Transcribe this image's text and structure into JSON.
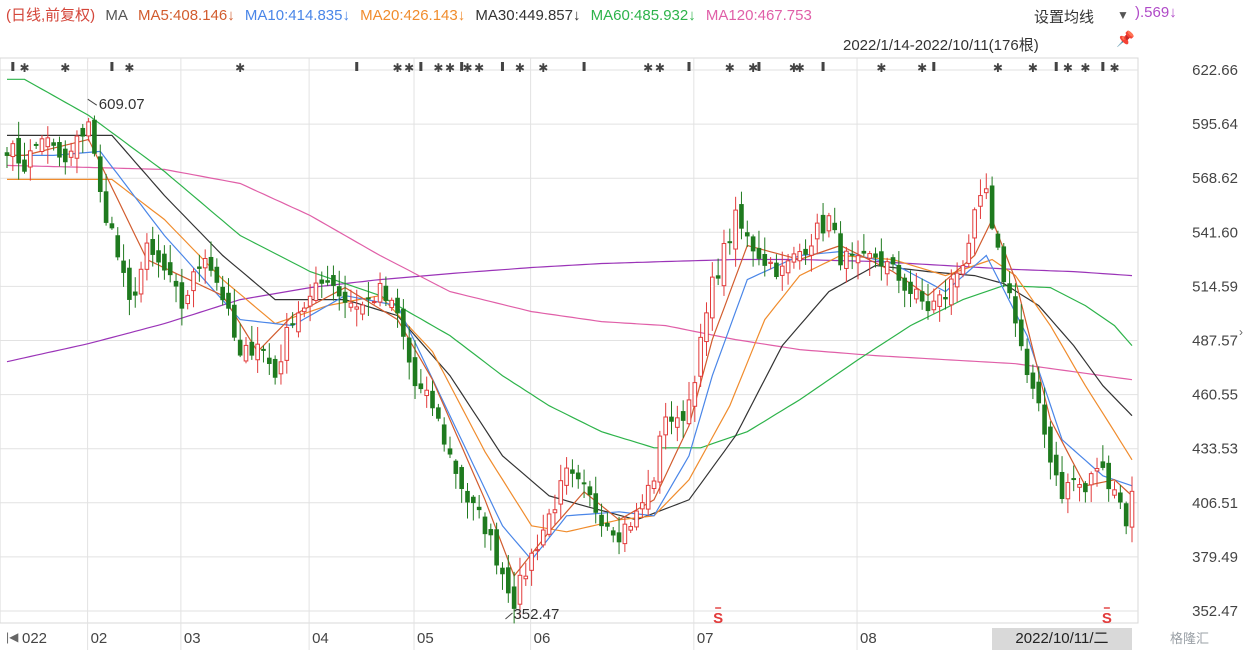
{
  "header": {
    "prefix": "(日线,前复权)",
    "ma_label": "MA",
    "ma5": "MA5:408.146↓",
    "ma10": "MA10:414.835↓",
    "ma20": "MA20:426.143↓",
    "ma30": "MA30:449.857↓",
    "ma60": "MA60:485.932↓",
    "ma120": "MA120:467.753",
    "ma_tail": ").569↓",
    "settings": "设置均线",
    "range": "2022/1/14-2022/10/11(176根)",
    "current_date": "2022/10/11/二",
    "watermark": "格隆汇",
    "nav_icon": "skip-back-icon",
    "pin_icon": "pin-icon",
    "colors": {
      "prefix": "#d4463a",
      "ma5": "#d25c2e",
      "ma10": "#4a86e8",
      "ma20": "#f08c2d",
      "ma30": "#333333",
      "ma60": "#2db34a",
      "ma120": "#e05fa8",
      "ma250": "#9b34b8",
      "up": "#e23b3b",
      "down": "#1f7a1f",
      "grid": "#e2e2e2"
    }
  },
  "chart_data": {
    "type": "candlestick",
    "y_ticks": [
      "622.66",
      "595.64",
      "568.62",
      "541.60",
      "514.59",
      "487.57",
      "460.55",
      "433.53",
      "406.51",
      "379.49",
      "352.47"
    ],
    "ylim": [
      352.47,
      622.66
    ],
    "x_labels": [
      "022",
      "02",
      "03",
      "04",
      "05",
      "06",
      "07",
      "08"
    ],
    "x_label_dates": [
      "2022-01-14",
      "2022-02-07",
      "2022-03-01",
      "2022-04-01",
      "2022-05-05",
      "2022-06-01",
      "2022-07-01",
      "2022-08-01"
    ],
    "annotations": [
      {
        "text": "609.07",
        "date": "2022-01-28",
        "value": 609.07
      },
      {
        "text": "352.47",
        "date": "2022-04-27",
        "value": 352.47
      }
    ],
    "signals": [
      {
        "text": "S",
        "date": "2022-06-29"
      },
      {
        "text": "S",
        "date": "2022-10-10"
      }
    ],
    "anchors": {
      "close": [
        [
          0,
          585
        ],
        [
          3,
          575
        ],
        [
          6,
          590
        ],
        [
          10,
          575
        ],
        [
          14,
          598
        ],
        [
          16,
          560
        ],
        [
          18,
          542
        ],
        [
          21,
          505
        ],
        [
          24,
          532
        ],
        [
          27,
          522
        ],
        [
          30,
          505
        ],
        [
          34,
          532
        ],
        [
          37,
          510
        ],
        [
          40,
          478
        ],
        [
          43,
          488
        ],
        [
          46,
          470
        ],
        [
          49,
          500
        ],
        [
          52,
          508
        ],
        [
          55,
          520
        ],
        [
          58,
          508
        ],
        [
          61,
          505
        ],
        [
          64,
          512
        ],
        [
          67,
          500
        ],
        [
          70,
          465
        ],
        [
          73,
          455
        ],
        [
          76,
          430
        ],
        [
          79,
          408
        ],
        [
          82,
          395
        ],
        [
          85,
          372
        ],
        [
          87,
          358
        ],
        [
          90,
          380
        ],
        [
          93,
          400
        ],
        [
          96,
          420
        ],
        [
          99,
          412
        ],
        [
          102,
          400
        ],
        [
          105,
          392
        ],
        [
          108,
          400
        ],
        [
          111,
          420
        ],
        [
          113,
          452
        ],
        [
          115,
          445
        ],
        [
          117,
          458
        ],
        [
          119,
          485
        ],
        [
          121,
          515
        ],
        [
          123,
          532
        ],
        [
          125,
          548
        ],
        [
          127,
          538
        ],
        [
          130,
          528
        ],
        [
          133,
          522
        ],
        [
          136,
          532
        ],
        [
          139,
          542
        ],
        [
          141,
          548
        ],
        [
          143,
          530
        ],
        [
          146,
          525
        ],
        [
          149,
          530
        ],
        [
          152,
          522
        ],
        [
          155,
          512
        ],
        [
          158,
          504
        ],
        [
          161,
          510
        ],
        [
          164,
          528
        ],
        [
          166,
          548
        ],
        [
          168,
          562
        ],
        [
          169,
          540
        ],
        [
          171,
          520
        ],
        [
          173,
          500
        ],
        [
          175,
          470
        ],
        [
          177,
          452
        ],
        [
          179,
          430
        ],
        [
          181,
          412
        ],
        [
          183,
          418
        ],
        [
          185,
          412
        ],
        [
          187,
          425
        ],
        [
          190,
          415
        ],
        [
          192,
          398
        ],
        [
          193,
          410
        ]
      ],
      "ma5": [
        [
          3,
          580
        ],
        [
          14,
          588
        ],
        [
          24,
          528
        ],
        [
          37,
          510
        ],
        [
          43,
          482
        ],
        [
          49,
          500
        ],
        [
          58,
          514
        ],
        [
          67,
          498
        ],
        [
          73,
          468
        ],
        [
          82,
          408
        ],
        [
          87,
          370
        ],
        [
          93,
          392
        ],
        [
          99,
          412
        ],
        [
          105,
          398
        ],
        [
          111,
          408
        ],
        [
          117,
          445
        ],
        [
          121,
          488
        ],
        [
          127,
          535
        ],
        [
          136,
          528
        ],
        [
          143,
          535
        ],
        [
          152,
          522
        ],
        [
          158,
          510
        ],
        [
          166,
          530
        ],
        [
          169,
          548
        ],
        [
          173,
          518
        ],
        [
          179,
          448
        ],
        [
          185,
          415
        ],
        [
          190,
          418
        ],
        [
          193,
          410
        ]
      ],
      "ma10": [
        [
          8,
          580
        ],
        [
          16,
          582
        ],
        [
          27,
          540
        ],
        [
          40,
          498
        ],
        [
          49,
          495
        ],
        [
          58,
          510
        ],
        [
          67,
          505
        ],
        [
          76,
          450
        ],
        [
          85,
          395
        ],
        [
          90,
          378
        ],
        [
          96,
          400
        ],
        [
          105,
          402
        ],
        [
          111,
          400
        ],
        [
          117,
          430
        ],
        [
          121,
          470
        ],
        [
          127,
          518
        ],
        [
          136,
          530
        ],
        [
          143,
          532
        ],
        [
          152,
          526
        ],
        [
          161,
          512
        ],
        [
          168,
          530
        ],
        [
          175,
          490
        ],
        [
          181,
          438
        ],
        [
          188,
          420
        ],
        [
          193,
          415
        ]
      ],
      "ma20": [
        [
          18,
          568
        ],
        [
          27,
          548
        ],
        [
          37,
          518
        ],
        [
          46,
          496
        ],
        [
          55,
          505
        ],
        [
          64,
          510
        ],
        [
          73,
          482
        ],
        [
          82,
          432
        ],
        [
          90,
          395
        ],
        [
          96,
          392
        ],
        [
          105,
          398
        ],
        [
          111,
          400
        ],
        [
          117,
          418
        ],
        [
          124,
          455
        ],
        [
          130,
          498
        ],
        [
          136,
          520
        ],
        [
          143,
          530
        ],
        [
          152,
          528
        ],
        [
          161,
          520
        ],
        [
          169,
          528
        ],
        [
          173,
          520
        ],
        [
          179,
          495
        ],
        [
          185,
          465
        ],
        [
          190,
          442
        ],
        [
          193,
          428
        ]
      ],
      "ma30": [
        [
          18,
          590
        ],
        [
          27,
          560
        ],
        [
          37,
          530
        ],
        [
          46,
          508
        ],
        [
          58,
          508
        ],
        [
          67,
          500
        ],
        [
          76,
          470
        ],
        [
          85,
          430
        ],
        [
          93,
          410
        ],
        [
          99,
          405
        ],
        [
          108,
          398
        ],
        [
          117,
          408
        ],
        [
          125,
          440
        ],
        [
          133,
          485
        ],
        [
          141,
          512
        ],
        [
          149,
          525
        ],
        [
          158,
          522
        ],
        [
          166,
          520
        ],
        [
          171,
          516
        ],
        [
          177,
          505
        ],
        [
          183,
          485
        ],
        [
          188,
          465
        ],
        [
          193,
          450
        ]
      ],
      "ma60": [
        [
          3,
          618
        ],
        [
          14,
          600
        ],
        [
          27,
          572
        ],
        [
          40,
          540
        ],
        [
          52,
          522
        ],
        [
          64,
          510
        ],
        [
          76,
          490
        ],
        [
          85,
          470
        ],
        [
          93,
          455
        ],
        [
          102,
          442
        ],
        [
          111,
          434
        ],
        [
          119,
          434
        ],
        [
          127,
          442
        ],
        [
          136,
          458
        ],
        [
          146,
          478
        ],
        [
          155,
          495
        ],
        [
          164,
          508
        ],
        [
          171,
          515
        ],
        [
          179,
          514
        ],
        [
          185,
          505
        ],
        [
          190,
          495
        ],
        [
          193,
          485
        ]
      ],
      "ma120": [
        [
          0,
          575
        ],
        [
          14,
          574
        ],
        [
          27,
          573
        ],
        [
          40,
          566
        ],
        [
          52,
          550
        ],
        [
          64,
          530
        ],
        [
          76,
          512
        ],
        [
          90,
          502
        ],
        [
          102,
          497
        ],
        [
          113,
          495
        ],
        [
          125,
          488
        ],
        [
          136,
          483
        ],
        [
          149,
          480
        ],
        [
          161,
          478
        ],
        [
          173,
          476
        ],
        [
          183,
          472
        ],
        [
          193,
          468
        ]
      ],
      "ma250": [
        [
          0,
          477
        ],
        [
          14,
          486
        ],
        [
          27,
          496
        ],
        [
          40,
          508
        ],
        [
          52,
          514
        ],
        [
          64,
          518
        ],
        [
          76,
          521
        ],
        [
          90,
          524
        ],
        [
          102,
          526
        ],
        [
          113,
          527
        ],
        [
          125,
          528
        ],
        [
          136,
          528
        ],
        [
          149,
          527
        ],
        [
          161,
          525
        ],
        [
          173,
          523
        ],
        [
          183,
          522
        ],
        [
          193,
          520
        ]
      ]
    }
  }
}
